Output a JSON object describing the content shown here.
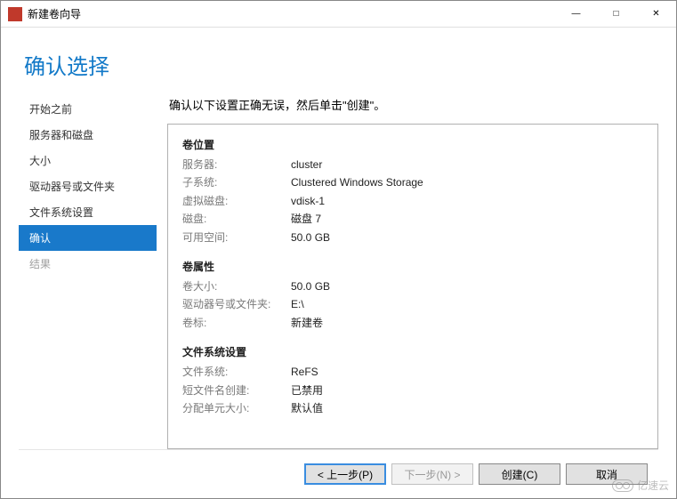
{
  "window": {
    "title": "新建卷向导"
  },
  "header": {
    "title": "确认选择"
  },
  "sidebar": {
    "items": [
      {
        "label": "开始之前"
      },
      {
        "label": "服务器和磁盘"
      },
      {
        "label": "大小"
      },
      {
        "label": "驱动器号或文件夹"
      },
      {
        "label": "文件系统设置"
      },
      {
        "label": "确认"
      },
      {
        "label": "结果"
      }
    ]
  },
  "instruction": "确认以下设置正确无误，然后单击\"创建\"。",
  "sections": {
    "location": {
      "title": "卷位置",
      "rows": [
        {
          "label": "服务器:",
          "value": "cluster"
        },
        {
          "label": "子系统:",
          "value": "Clustered Windows Storage"
        },
        {
          "label": "虚拟磁盘:",
          "value": "vdisk-1"
        },
        {
          "label": "磁盘:",
          "value": "磁盘 7"
        },
        {
          "label": "可用空间:",
          "value": "50.0 GB"
        }
      ]
    },
    "properties": {
      "title": "卷属性",
      "rows": [
        {
          "label": "卷大小:",
          "value": "50.0 GB"
        },
        {
          "label": "驱动器号或文件夹:",
          "value": "E:\\"
        },
        {
          "label": "卷标:",
          "value": "新建卷"
        }
      ]
    },
    "filesystem": {
      "title": "文件系统设置",
      "rows": [
        {
          "label": "文件系统:",
          "value": "ReFS"
        },
        {
          "label": "短文件名创建:",
          "value": "已禁用"
        },
        {
          "label": "分配单元大小:",
          "value": "默认值"
        }
      ]
    }
  },
  "buttons": {
    "previous": "< 上一步(P)",
    "next": "下一步(N) >",
    "create": "创建(C)",
    "cancel": "取消"
  },
  "watermark": "亿速云"
}
